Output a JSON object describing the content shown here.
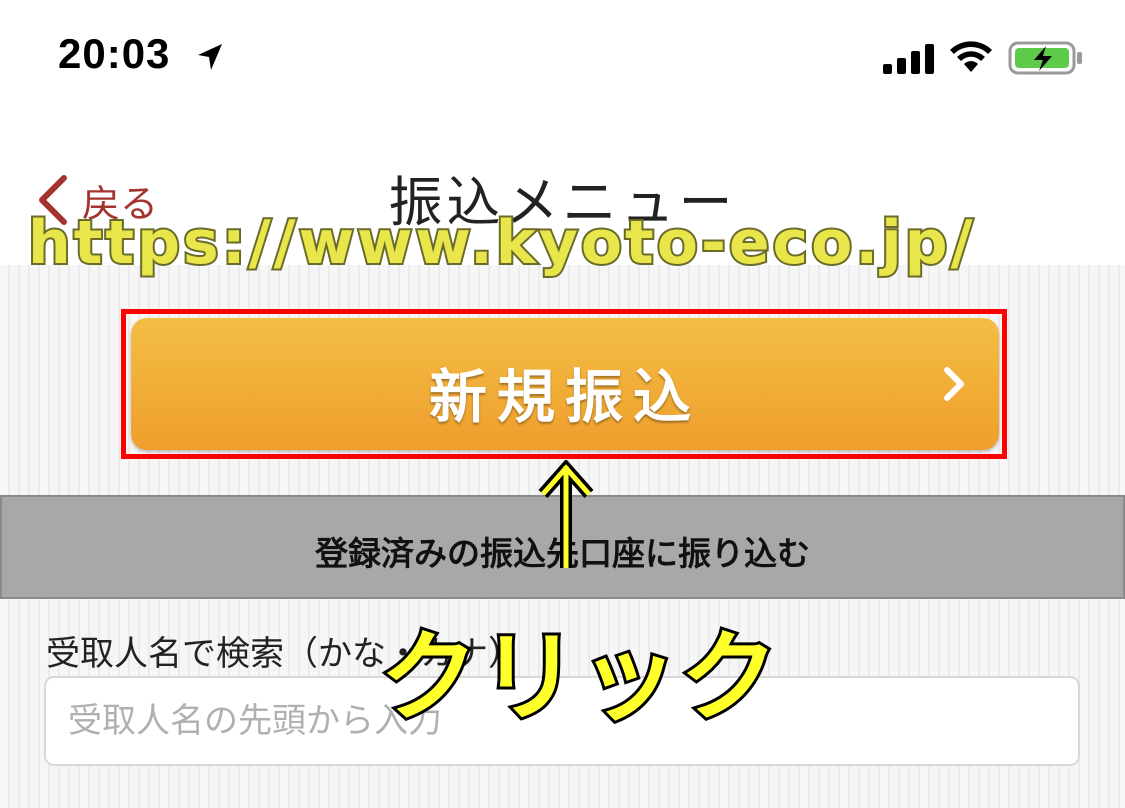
{
  "status_bar": {
    "time": "20:03",
    "icons": [
      "location-arrow-icon",
      "cellular-signal-icon",
      "wifi-icon",
      "battery-charging-icon"
    ]
  },
  "nav": {
    "back_label": "戻る",
    "title": "振込メニュー"
  },
  "overlay": {
    "url_watermark": "https://www.kyoto-eco.jp/",
    "click_annotation": "クリック",
    "highlight_color": "#ff0000",
    "annotation_color": "#ffff2a"
  },
  "main": {
    "new_transfer_label": "新規振込",
    "registered_label": "登録済みの振込先口座に振り込む",
    "search": {
      "label": "受取人名で検索（かな・カナ）",
      "placeholder": "受取人名の先頭から入力",
      "value": ""
    }
  },
  "colors": {
    "accent": "#a3342f",
    "button_top": "#f3be45",
    "button_bottom": "#ef9e2c",
    "bar_gray": "#a8a8a8"
  }
}
